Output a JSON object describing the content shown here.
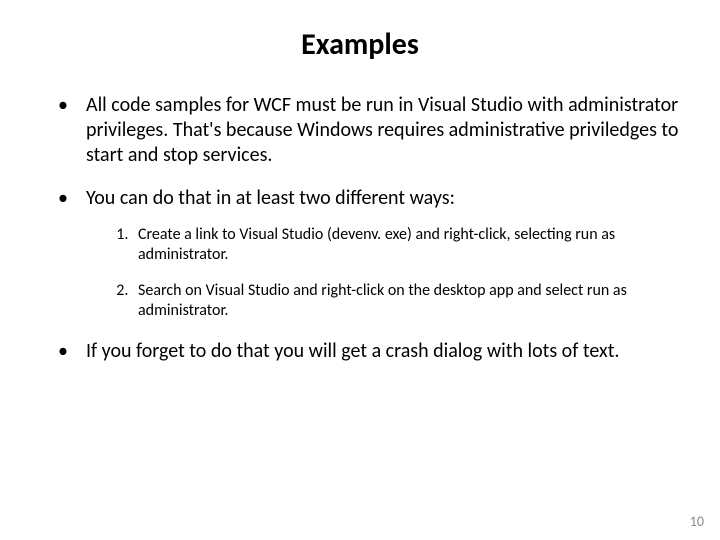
{
  "title": "Examples",
  "bullets": {
    "b1": "All code samples for WCF must be run in Visual Studio with administrator privileges.  That's because Windows requires administrative priviledges to start and stop services.",
    "b2": "You can do that in at least two different ways:",
    "b3": "If you forget to do that you will get a crash dialog with lots of text."
  },
  "sub": {
    "s1": "Create a link to Visual Studio (devenv. exe) and right-click, selecting run as administrator.",
    "s2": "Search on Visual Studio and right-click on the desktop app and select run as administrator."
  },
  "page_number": "10"
}
